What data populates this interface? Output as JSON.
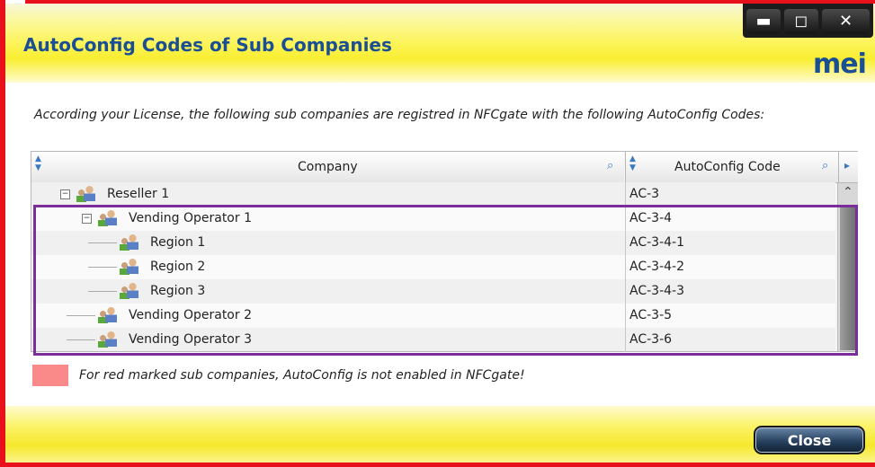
{
  "window": {
    "title": "AutoConfig Codes of Sub Companies",
    "logo": "mei",
    "minimize_glyph": "▬",
    "maximize_glyph": "◻",
    "close_glyph": "✕"
  },
  "instruction": "According your License, the following sub companies are registred in NFCgate with the following AutoConfig Codes:",
  "table": {
    "columns": [
      "Company",
      "AutoConfig Code"
    ],
    "rows": [
      {
        "company": "Reseller 1",
        "code": "AC-3"
      },
      {
        "company": "Vending Operator 1",
        "code": "AC-3-4"
      },
      {
        "company": "Region 1",
        "code": "AC-3-4-1"
      },
      {
        "company": "Region 2",
        "code": "AC-3-4-2"
      },
      {
        "company": "Region 3",
        "code": "AC-3-4-3"
      },
      {
        "company": "Vending Operator 2",
        "code": "AC-3-5"
      },
      {
        "company": "Vending Operator 3",
        "code": "AC-3-6"
      }
    ],
    "expanded_glyph": "−",
    "scroll_up_glyph": "⌃",
    "scroll_right_glyph": "▸"
  },
  "legend": {
    "text": "For red marked sub companies, AutoConfig is not enabled in NFCgate!",
    "swatch_color": "#fa8a8a"
  },
  "buttons": {
    "close_label": "Close"
  },
  "colors": {
    "frame_red": "#e8101a",
    "title_blue": "#1a4f96",
    "highlight_purple": "#7b2d9c",
    "header_yellow": "#fdf45a"
  }
}
